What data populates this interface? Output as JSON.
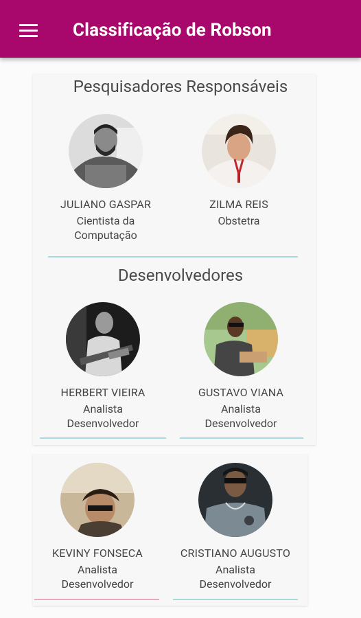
{
  "app_title": "Classificação de Robson",
  "menu_icon": "hamburger-menu-icon",
  "colors": {
    "primary": "#a8086b",
    "divider_teal": "#a9d9dc",
    "divider_pink": "#e8a7c2"
  },
  "sections": {
    "researchers": {
      "title": "Pesquisadores Responsáveis",
      "people": [
        {
          "name": "JULIANO GASPAR",
          "role": "Cientista da Computação"
        },
        {
          "name": "ZILMA REIS",
          "role": "Obstetra"
        }
      ]
    },
    "developers": {
      "title": "Desenvolvedores",
      "people": [
        {
          "name": "HERBERT VIEIRA",
          "role": "Analista Desenvolvedor"
        },
        {
          "name": "GUSTAVO VIANA",
          "role": "Analista Desenvolvedor"
        },
        {
          "name": "KEVINY FONSECA",
          "role": "Analista Desenvolvedor"
        },
        {
          "name": "CRISTIANO AUGUSTO",
          "role": "Analista Desenvolvedor"
        }
      ]
    }
  }
}
